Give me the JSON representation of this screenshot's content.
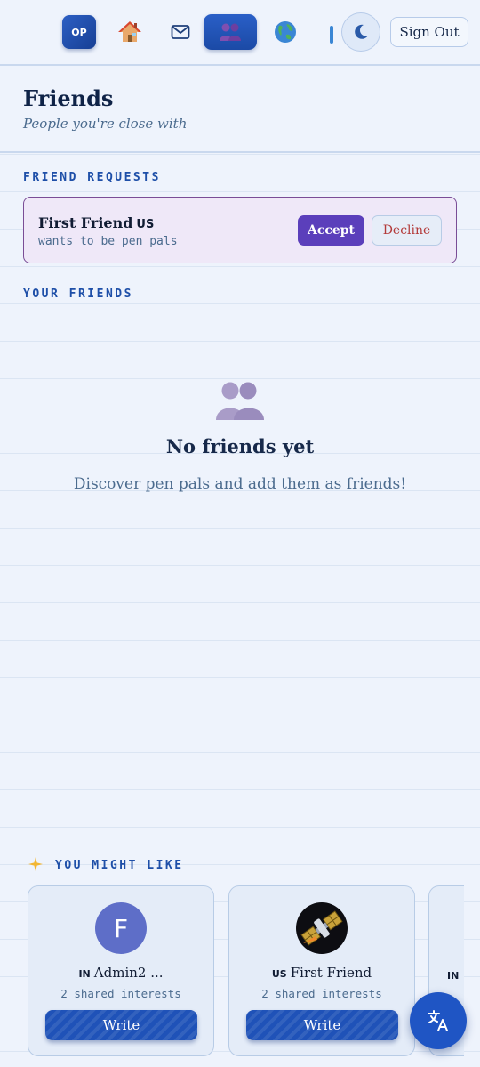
{
  "nav": {
    "logo_text": "OP",
    "items": [
      {
        "icon": "house-icon"
      },
      {
        "icon": "envelope-icon"
      },
      {
        "icon": "friends-icon",
        "active": true
      },
      {
        "icon": "globe-icon"
      }
    ],
    "theme_icon": "moon-icon",
    "sign_out_label": "Sign Out"
  },
  "header": {
    "title": "Friends",
    "subtitle": "People you're close with"
  },
  "requests": {
    "section_label": "FRIEND REQUESTS",
    "items": [
      {
        "name": "First Friend",
        "country": "US",
        "subtitle": "wants to be pen pals",
        "accept_label": "Accept",
        "decline_label": "Decline"
      }
    ]
  },
  "friends": {
    "section_label": "YOUR FRIENDS",
    "empty_icon": "friends-icon",
    "empty_title": "No friends yet",
    "empty_text": "Discover pen pals and add them as friends!"
  },
  "suggestions": {
    "section_label": "YOU MIGHT LIKE",
    "section_icon": "sparkle-icon",
    "cards": [
      {
        "avatar_letter": "F",
        "country": "IN",
        "name": "Admin2 ...",
        "shared": "2 shared interests",
        "write_label": "Write"
      },
      {
        "avatar_icon": "satellite-icon",
        "country": "US",
        "name": "First Friend",
        "shared": "2 shared interests",
        "write_label": "Write"
      },
      {
        "country": "IN"
      }
    ]
  },
  "fab": {
    "icon": "translate-icon"
  },
  "colors": {
    "accent": "#1f55c4",
    "accept": "#5b3fbb",
    "decline": "#b33a3a",
    "request_border": "#7a4d96"
  }
}
